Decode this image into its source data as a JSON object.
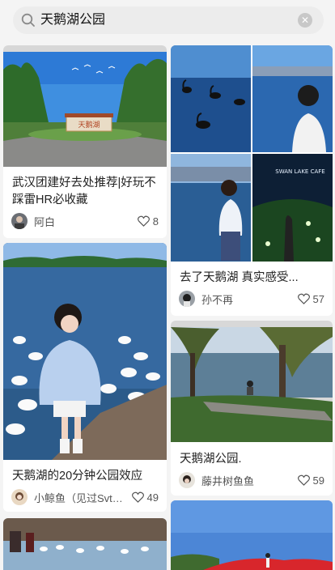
{
  "search": {
    "query": "天鹅湖公园"
  },
  "cards": [
    {
      "title": "武汉团建好去处推荐|好玩不踩雷HR必收藏",
      "author": "阿白",
      "likes": "8",
      "image_caption": "天鹅湖"
    },
    {
      "title": "去了天鹅湖 真实感受...",
      "author": "孙不再",
      "likes": "57",
      "image_caption": "SWAN LAKE CAFE"
    },
    {
      "title": "天鹅湖的20分钟公园效应",
      "author": "小鲸鱼（见过Svt版...",
      "likes": "49"
    },
    {
      "title": "天鹅湖公园.",
      "author": "藤井树鱼鱼",
      "likes": "59"
    }
  ],
  "colors": {
    "accent": "#ff2442",
    "page_bg": "#f4f4f4"
  }
}
